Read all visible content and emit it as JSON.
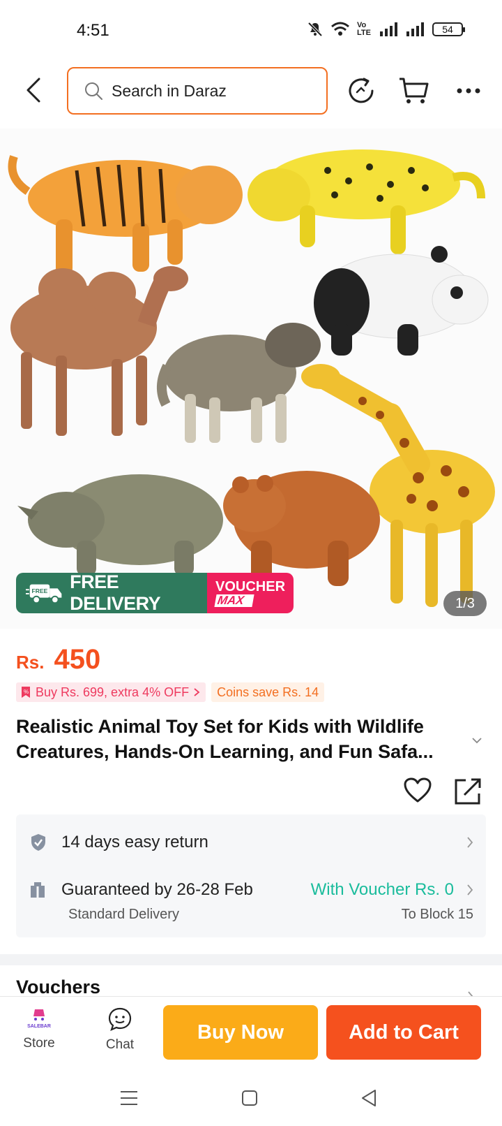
{
  "status_bar": {
    "time": "4:51",
    "network_label": "Vo LTE",
    "battery": "54"
  },
  "header": {
    "search_placeholder": "Search in Daraz"
  },
  "product": {
    "image_counter": "1/3",
    "badge_free_delivery": "FREE DELIVERY",
    "badge_free_small": "FREE",
    "badge_voucher_line1": "VOUCHER",
    "badge_voucher_line2": "MAX",
    "price_currency": "Rs.",
    "price_amount": "450",
    "promo_text": "Buy Rs. 699, extra 4% OFF",
    "coins_text": "Coins save Rs. 14",
    "title": "Realistic Animal Toy Set for Kids with Wildlife Creatures, Hands-On Learning, and Fun Safa..."
  },
  "service": {
    "return_text": "14 days easy return",
    "delivery_text": "Guaranteed by 26-28 Feb",
    "delivery_sub": "Standard Delivery",
    "voucher_text": "With Voucher Rs. 0",
    "location_text": "To Block 15"
  },
  "vouchers": {
    "title": "Vouchers"
  },
  "bottom_bar": {
    "store_label": "Store",
    "store_logo_text": "SALEBAR",
    "chat_label": "Chat",
    "buy_now_label": "Buy Now",
    "add_to_cart_label": "Add to Cart"
  },
  "colors": {
    "accent_orange": "#f5511e",
    "buy_now_yellow": "#fbab18",
    "voucher_teal": "#1abc9c",
    "free_delivery_green": "#2f7a5d",
    "voucher_pink": "#ee1f5c"
  }
}
